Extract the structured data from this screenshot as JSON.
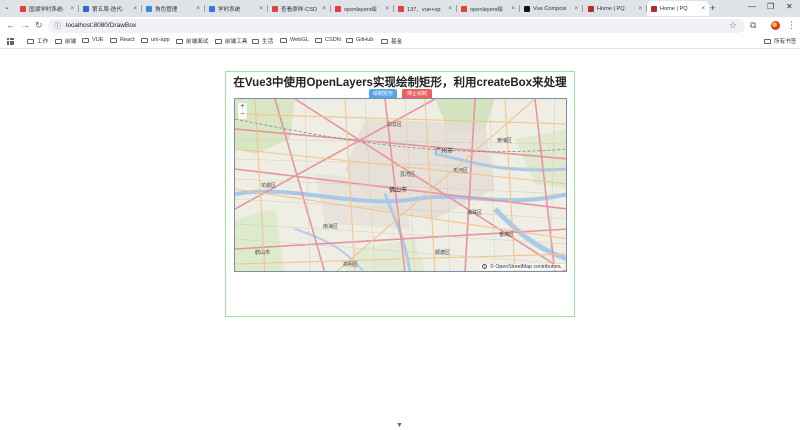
{
  "browser": {
    "tabs": [
      {
        "title": "国湖学时系统-",
        "favicon_color": "#e2403b"
      },
      {
        "title": "第五周-迭代-",
        "favicon_color": "#2a68d8"
      },
      {
        "title": "角色管理",
        "favicon_color": "#2f8fde"
      },
      {
        "title": "学时系统",
        "favicon_color": "#3478e3"
      },
      {
        "title": "查看原样-CSD",
        "favicon_color": "#e0413a"
      },
      {
        "title": "openlayers绘",
        "favicon_color": "#e0413a"
      },
      {
        "title": "137、vue+op",
        "favicon_color": "#e0413a"
      },
      {
        "title": "openlayers绘",
        "favicon_color": "#e0413a"
      },
      {
        "title": "Vue Composi",
        "favicon_color": "#111111"
      },
      {
        "title": "Home | PQ",
        "favicon_color": "#b32e2e"
      },
      {
        "title": "Home | PQ",
        "favicon_color": "#b32e2e",
        "active": true
      }
    ],
    "close_glyph": "×",
    "new_tab_glyph": "+",
    "window_controls": {
      "minimize": "—",
      "maximize": "❐",
      "close": "✕"
    },
    "url": "localhost:8080/DrawBox",
    "nav": {
      "back": "←",
      "forward": "→",
      "reload": "↻"
    },
    "bookmarks": [
      "工作",
      "前端",
      "VUE",
      "React",
      "uni-app",
      "前端面试",
      "前端工具",
      "生活",
      "WebGL",
      "CSDN",
      "GitHub",
      "基金"
    ],
    "all_bookmarks": "所有书签"
  },
  "page": {
    "title": "在Vue3中使用OpenLayers实现绘制矩形，利用createBox来处理",
    "draw_button": "绘制矩形",
    "stop_button": "停止绘制",
    "zoom_in": "+",
    "zoom_out": "−",
    "attribution_symbol": "©",
    "attribution_text": "OpenStreetMap contributors.",
    "map_labels": {
      "guangzhou": "广州市",
      "foshan": "佛山市",
      "baiyun": "白云区",
      "huangpu": "黄埔区",
      "tianhe": "天河区",
      "haizhu": "海珠区",
      "panyu": "番禺区",
      "nanhai": "南海区",
      "shunde": "顺德区",
      "huadu": "花都区",
      "liwan": "荔湾区",
      "gaoming": "高明区",
      "jiangmen": "鹤山市"
    }
  },
  "colors": {
    "accent_blue": "#58a6e8",
    "stop_red": "#ea5f5f",
    "container_border": "#9be3a1"
  }
}
